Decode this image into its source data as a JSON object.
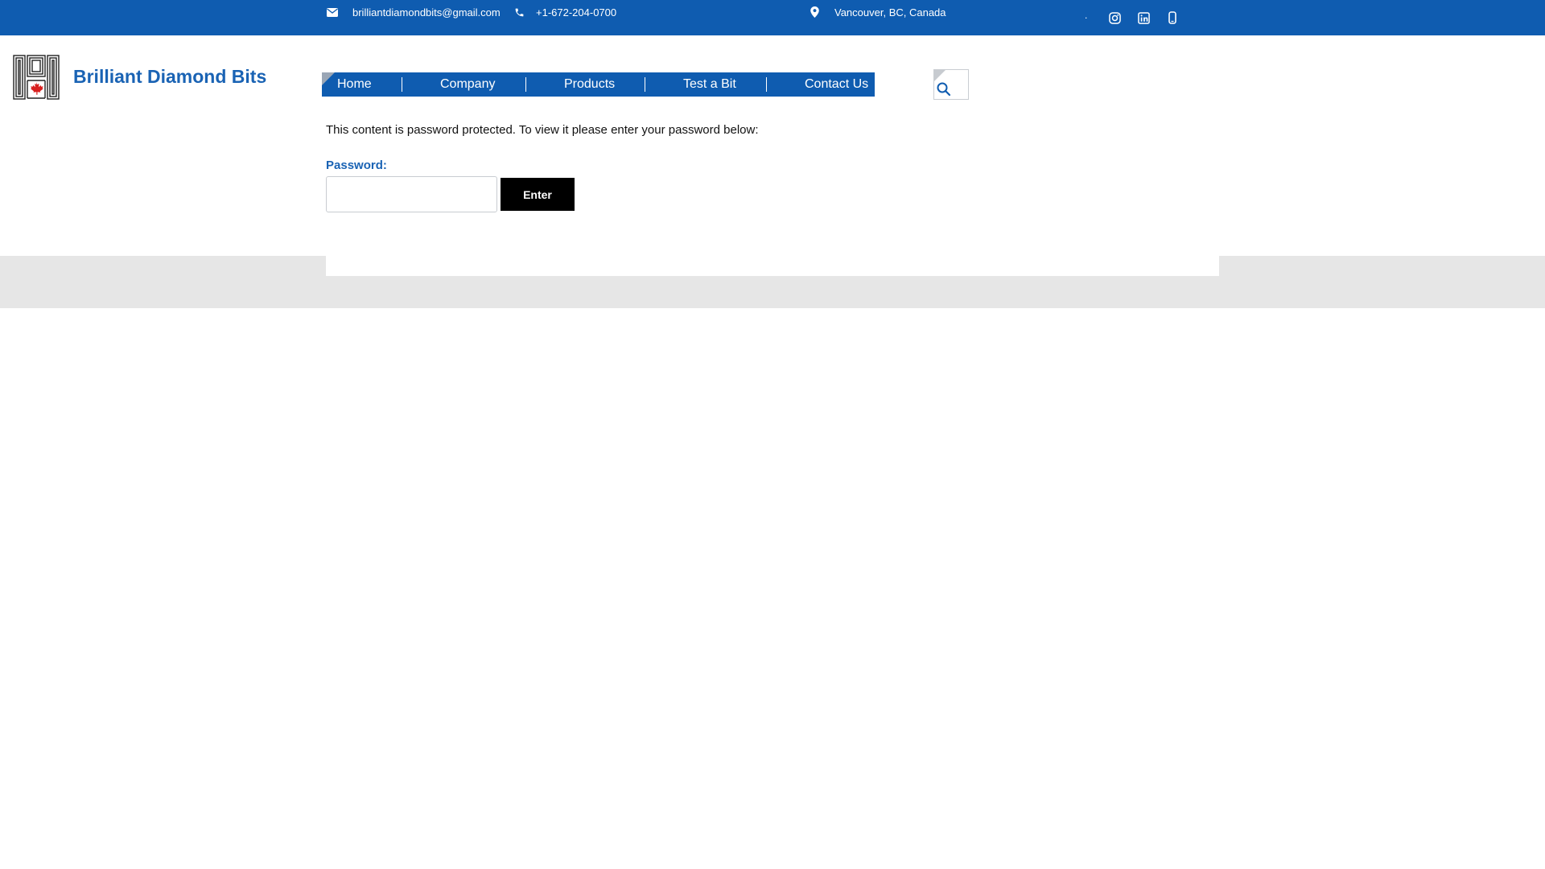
{
  "topbar": {
    "email": "brilliantdiamondbits@gmail.com",
    "phone": "+1-672-204-0700",
    "location": "Vancouver, BC, Canada",
    "separator": ".",
    "social_icons": [
      "instagram-icon",
      "linkedin-icon",
      "phone-icon"
    ],
    "background_color": "#0f5cb0"
  },
  "brand": {
    "name": "Brilliant Diamond Bits",
    "logo_icon": "maple-leaf-logo",
    "color": "#1a63b4"
  },
  "nav": {
    "items": [
      {
        "label": "Home"
      },
      {
        "label": "Company"
      },
      {
        "label": "Products"
      },
      {
        "label": "Test a Bit"
      },
      {
        "label": "Contact Us"
      }
    ],
    "background_color": "#0f5cb0"
  },
  "search": {
    "icon": "search-icon"
  },
  "content": {
    "message": "This content is password protected. To view it please enter your password below:",
    "password_label": "Password:",
    "password_value": "",
    "enter_label": "Enter"
  }
}
